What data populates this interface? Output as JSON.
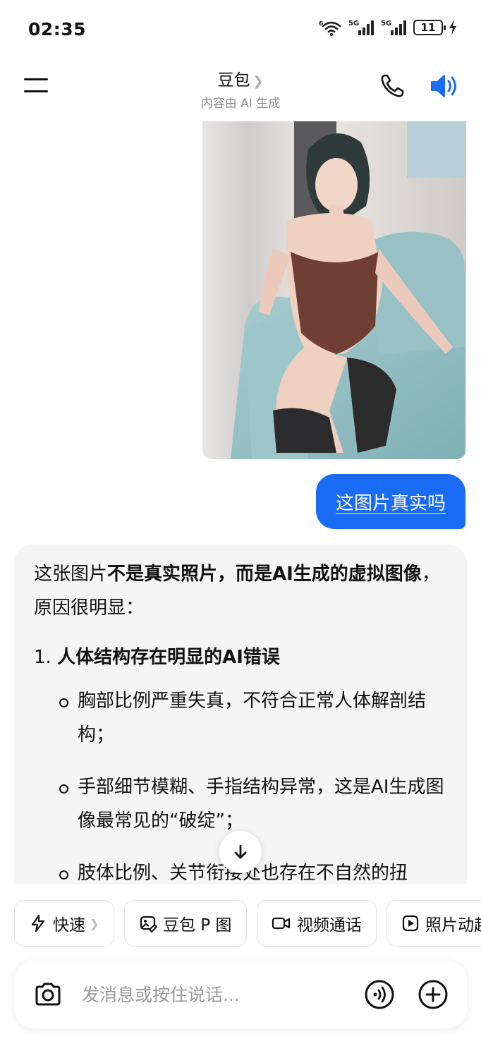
{
  "status_bar": {
    "time": "02:35",
    "battery": "11",
    "signal_label_1": "5G",
    "signal_label_2": "5G",
    "wifi_label": "6"
  },
  "header": {
    "title": "豆包",
    "subtitle": "内容由 AI 生成"
  },
  "chat": {
    "user_message": "这图片真实吗",
    "ai_reply": {
      "intro_prefix": "这张图片",
      "intro_bold": "不是真实照片，而是AI生成的虚拟图像",
      "intro_suffix": "，原因很明显：",
      "points": [
        {
          "number": "1.",
          "title": "人体结构存在明显的AI错误",
          "bullets": [
            "胸部比例严重失真，不符合正常人体解剖结构；",
            "手部细节模糊、手指结构异常，这是AI生成图像最常见的“破绽”；",
            "肢体比例、关节衔接处也存在不自然的扭"
          ]
        }
      ]
    }
  },
  "quick_actions": [
    {
      "label": "快速",
      "icon": "lightning-icon"
    },
    {
      "label": "豆包 P 图",
      "icon": "image-edit-icon"
    },
    {
      "label": "视频通话",
      "icon": "video-camera-icon"
    },
    {
      "label": "照片动起",
      "icon": "play-icon"
    }
  ],
  "composer": {
    "placeholder": "发消息或按住说话..."
  },
  "colors": {
    "accent": "#1a6cf5",
    "card_bg": "#f5f5f6",
    "chair": "#8fbcc0"
  }
}
